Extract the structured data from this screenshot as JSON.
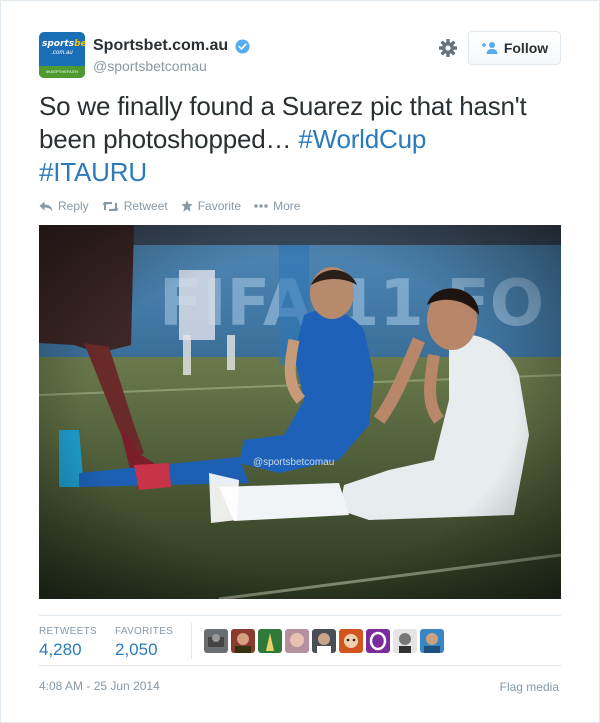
{
  "user": {
    "display_name": "Sportsbet.com.au",
    "handle": "@sportsbetcomau",
    "avatar": {
      "logo_text": "sportsbet",
      "logo_sub": ".com.au",
      "band_text": "#KEEPTHEFAITH"
    }
  },
  "header": {
    "follow_label": "Follow"
  },
  "tweet": {
    "text_plain": "So we finally found a Suarez pic that hasn't been photoshopped… ",
    "hashtag_1": "#WorldCup",
    "hashtag_2": "#ITAURU"
  },
  "actions": {
    "reply": "Reply",
    "retweet": "Retweet",
    "favorite": "Favorite",
    "more": "More"
  },
  "photo": {
    "watermark": "@sportsbetcomau"
  },
  "stats": {
    "retweets_label": "RETWEETS",
    "retweets_value": "4,280",
    "favorites_label": "FAVORITES",
    "favorites_value": "2,050"
  },
  "footer": {
    "timestamp": "4:08 AM - 25 Jun 2014",
    "flag_media": "Flag media"
  },
  "colors": {
    "link_blue": "#2b7bb9",
    "muted_gray": "#8899a6",
    "verified_blue": "#55acee"
  }
}
